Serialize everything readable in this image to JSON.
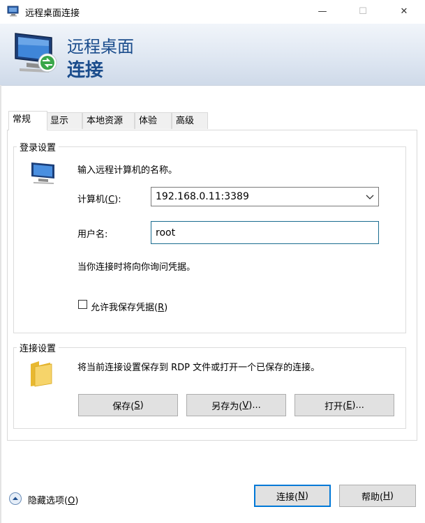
{
  "window": {
    "title": "远程桌面连接",
    "controls": {
      "minimize": "—",
      "maximize": "☐",
      "close": "✕"
    }
  },
  "banner": {
    "line1": "远程桌面",
    "line2": "连接"
  },
  "tabs": [
    {
      "label": "常规",
      "active": true
    },
    {
      "label": "显示",
      "active": false
    },
    {
      "label": "本地资源",
      "active": false
    },
    {
      "label": "体验",
      "active": false
    },
    {
      "label": "高级",
      "active": false
    }
  ],
  "login": {
    "group_label": "登录设置",
    "instruction": "输入远程计算机的名称。",
    "computer_label": "计算机(",
    "computer_key": "C",
    "computer_label_end": "):",
    "computer_value": "192.168.0.11:3389",
    "username_label": "用户名:",
    "username_value": "root",
    "note": "当你连接时将向你询问凭据。",
    "save_creds_label": "允许我保存凭据(",
    "save_creds_key": "R",
    "save_creds_end": ")",
    "save_creds_checked": false
  },
  "connection": {
    "group_label": "连接设置",
    "description": "将当前连接设置保存到 RDP 文件或打开一个已保存的连接。",
    "save": {
      "label": "保存(",
      "key": "S",
      "end": ")"
    },
    "save_as": {
      "label": "另存为(",
      "key": "V",
      "end": ")..."
    },
    "open": {
      "label": "打开(",
      "key": "E",
      "end": ")..."
    }
  },
  "footer": {
    "hide_options": {
      "label": "隐藏选项(",
      "key": "O",
      "end": ")"
    },
    "connect": {
      "label": "连接(",
      "key": "N",
      "end": ")"
    },
    "help": {
      "label": "帮助(",
      "key": "H",
      "end": ")"
    }
  },
  "colors": {
    "banner_text": "#1a4c8c",
    "accent": "#0078d7"
  }
}
